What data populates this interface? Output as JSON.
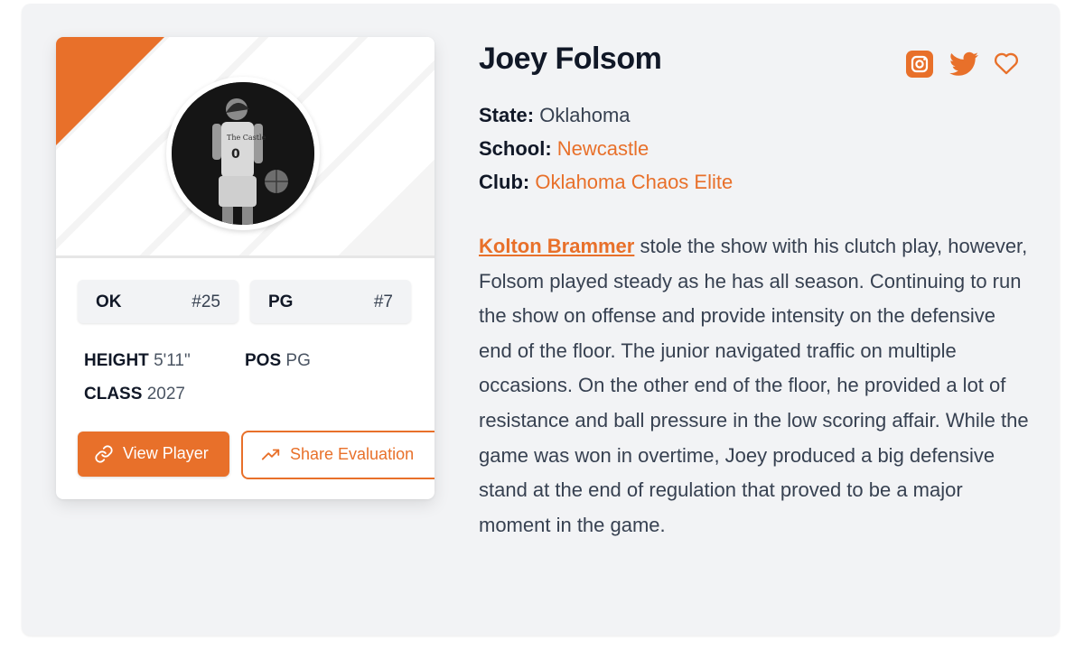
{
  "player": {
    "name": "Joey Folsom",
    "state_label": "State:",
    "state": "Oklahoma",
    "school_label": "School:",
    "school": "Newcastle",
    "club_label": "Club:",
    "club": "Oklahoma Chaos Elite"
  },
  "rankings": [
    {
      "label": "OK",
      "value": "#25"
    },
    {
      "label": "PG",
      "value": "#7"
    }
  ],
  "stats": {
    "height_label": "HEIGHT",
    "height": "5'11\"",
    "pos_label": "POS",
    "pos": "PG",
    "class_label": "CLASS",
    "class": "2027"
  },
  "buttons": {
    "view_player": "View Player",
    "share_evaluation": "Share Evaluation"
  },
  "evaluation": {
    "mention": "Kolton Brammer",
    "text": " stole the show with his clutch play, however, Folsom played steady as he has all season. Continuing to run the show on offense and provide intensity on the defensive end of the floor. The junior navigated traffic on multiple occasions. On the other end of the floor, he provided a lot of resistance and ball pressure in the low scoring affair. While the game was won in overtime, Joey produced a big defensive stand at the end of regulation that proved to be a major moment in the game."
  },
  "icons": {
    "instagram": "instagram-icon",
    "twitter": "twitter-icon",
    "favorite": "heart-icon",
    "link": "link-icon",
    "trend": "trending-up-icon"
  },
  "colors": {
    "accent": "#e8702a",
    "panel_background": "#f2f3f5",
    "text_dark": "#111827"
  }
}
